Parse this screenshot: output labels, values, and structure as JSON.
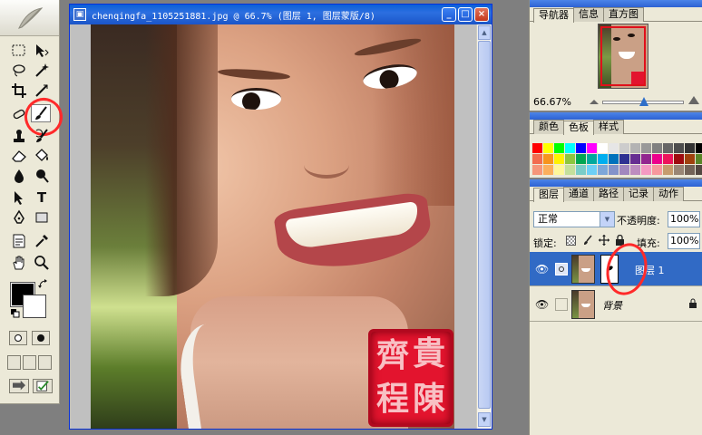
{
  "document": {
    "title": "chenqingfa_1105251881.jpg @ 66.7% (图层 1, 图层蒙版/8)",
    "seal_text": [
      "齊",
      "貴",
      "程",
      "陳"
    ]
  },
  "toolbox": {
    "tools": [
      "marquee-icon",
      "move-icon",
      "lasso-icon",
      "magic-wand-icon",
      "crop-icon",
      "slice-icon",
      "healing-icon",
      "brush-icon",
      "stamp-icon",
      "history-brush-icon",
      "eraser-icon",
      "bucket-icon",
      "blur-icon",
      "dodge-icon",
      "path-select-icon",
      "type-icon",
      "pen-icon",
      "shape-icon",
      "notes-icon",
      "eyedropper-icon",
      "hand-icon",
      "zoom-icon"
    ],
    "type_glyph": "T",
    "active_tool": "brush-icon",
    "highlight_color": "#ff2a2a"
  },
  "navigator": {
    "tabs": [
      "导航器",
      "信息",
      "直方图"
    ],
    "zoom": "66.67%"
  },
  "color": {
    "tabs": [
      "颜色",
      "色板",
      "样式"
    ],
    "swatches": [
      "#ff0000",
      "#ffff00",
      "#00ff00",
      "#00ffff",
      "#0000ff",
      "#ff00ff",
      "#ffffff",
      "#e6e6e6",
      "#cccccc",
      "#b3b3b3",
      "#999999",
      "#808080",
      "#666666",
      "#4d4d4d",
      "#333333",
      "#000000",
      "#f26c4f",
      "#f7941d",
      "#fff200",
      "#8dc63f",
      "#00a651",
      "#00a99d",
      "#00aeef",
      "#0072bc",
      "#2e3192",
      "#662d91",
      "#92278f",
      "#ec008c",
      "#ed145b",
      "#9e0b0f",
      "#a0410d",
      "#598527",
      "#f69679",
      "#fbaf5d",
      "#fff799",
      "#c4df9b",
      "#7accc8",
      "#6dcff6",
      "#7da7d9",
      "#8393ca",
      "#a187be",
      "#bd8cbf",
      "#f49ac2",
      "#f6989d",
      "#c69c6d",
      "#998675",
      "#736357",
      "#534741"
    ]
  },
  "layers": {
    "tabs": [
      "图层",
      "通道",
      "路径",
      "记录",
      "动作"
    ],
    "blend_mode": "正常",
    "opacity_label": "不透明度:",
    "opacity": "100%",
    "lock_label": "锁定:",
    "fill_label": "填充:",
    "fill": "100%",
    "items": [
      {
        "name": "图层 1",
        "selected": true
      },
      {
        "name": "背景",
        "selected": false
      }
    ]
  }
}
